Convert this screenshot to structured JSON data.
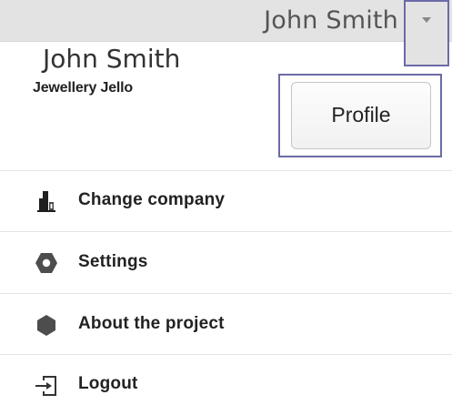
{
  "header": {
    "user_name": "John Smith",
    "dropdown_icon": "caret-down-icon"
  },
  "profile": {
    "name": "John Smith",
    "company": "Jewellery Jello",
    "button_label": "Profile"
  },
  "menu": {
    "items": [
      {
        "label": "Change company",
        "icon": "building-icon"
      },
      {
        "label": "Settings",
        "icon": "hexagon-icon"
      },
      {
        "label": "About the project",
        "icon": "info-hexagon-icon"
      },
      {
        "label": "Logout",
        "icon": "logout-icon"
      }
    ]
  },
  "colors": {
    "highlight_border": "#6b6ba8",
    "header_background": "#e3e3e3",
    "text": "#222222"
  }
}
